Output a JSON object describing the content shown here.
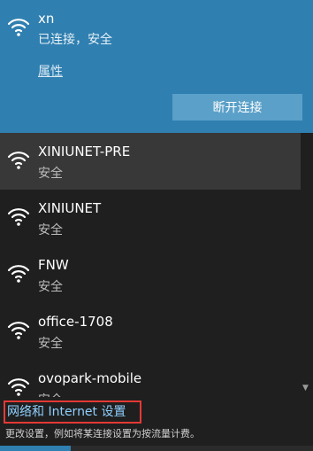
{
  "connected": {
    "ssid": "xn",
    "status": "已连接，安全",
    "properties_label": "属性",
    "disconnect_label": "断开连接"
  },
  "networks": [
    {
      "name": "XINIUNET-PRE",
      "security": "安全"
    },
    {
      "name": "XINIUNET",
      "security": "安全"
    },
    {
      "name": "FNW",
      "security": "安全"
    },
    {
      "name": "office-1708",
      "security": "安全"
    },
    {
      "name": "ovopark-mobile",
      "security": "安全"
    }
  ],
  "footer": {
    "settings_link": "网络和 Internet 设置",
    "settings_hint": "更改设置，例如将某连接设置为按流量计费。"
  },
  "colors": {
    "accent": "#2f7fb0",
    "highlight_border": "#e53935",
    "link": "#8fd0ff"
  },
  "icons": {
    "wifi": "wifi-icon",
    "scroll_down": "chevron-down-icon"
  }
}
